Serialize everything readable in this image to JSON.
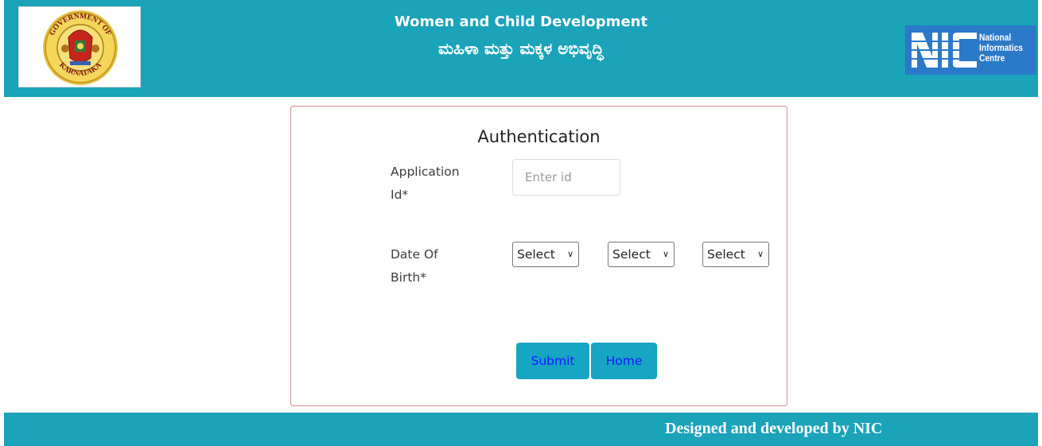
{
  "header": {
    "title": "Women and Child Development",
    "subtitle": "ಮಹಿಳಾ ಮತ್ತು ಮಕ್ಕಳ ಅಭಿವೃದ್ಧಿ",
    "left_logo": {
      "icon": "karnataka-emblem-icon",
      "ring_text_top": "GOVERNMENT OF",
      "ring_text_bottom": "KARNATAKA"
    },
    "right_logo": {
      "icon": "nic-logo-icon",
      "line1": "National",
      "line2": "Informatics",
      "line3": "Centre"
    }
  },
  "form": {
    "title": "Authentication",
    "application_id": {
      "label_line1": "Application",
      "label_line2": "Id*",
      "placeholder": "Enter id",
      "value": ""
    },
    "dob": {
      "label_line1": "Date Of",
      "label_line2": "Birth*",
      "day": "Select",
      "month": "Select",
      "year": "Select"
    },
    "submit_label": "Submit",
    "home_label": "Home"
  },
  "footer": {
    "text": "Designed and developed by NIC"
  },
  "colors": {
    "brand": "#1aa3b9",
    "button": "#16a5c2",
    "button_text": "#1818ff",
    "card_border": "#e18a94",
    "nic_blue": "#2b79c9"
  }
}
